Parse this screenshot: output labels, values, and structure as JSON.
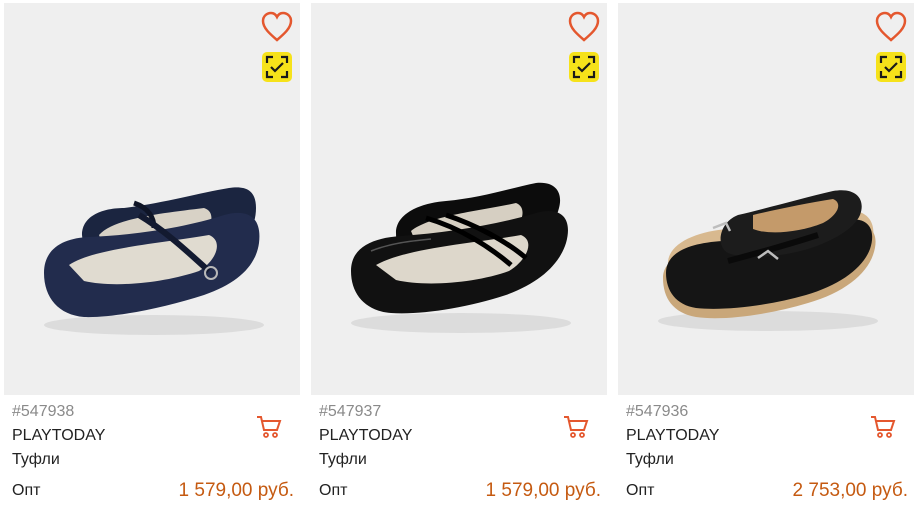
{
  "products": [
    {
      "article": "#547938",
      "brand": "PLAYTODAY",
      "type": "Туфли",
      "price_label": "Опт",
      "price": "1 579,00 руб."
    },
    {
      "article": "#547937",
      "brand": "PLAYTODAY",
      "type": "Туфли",
      "price_label": "Опт",
      "price": "1 579,00 руб."
    },
    {
      "article": "#547936",
      "brand": "PLAYTODAY",
      "type": "Туфли",
      "price_label": "Опт",
      "price": "2 753,00 руб."
    }
  ],
  "icons": {
    "favorite": "heart-icon",
    "scan": "scan-check-icon",
    "cart": "cart-icon"
  },
  "colors": {
    "accent": "#e4572e",
    "price": "#c55a11",
    "scan_badge": "#f6e21a",
    "photo_bg": "#efefef"
  }
}
